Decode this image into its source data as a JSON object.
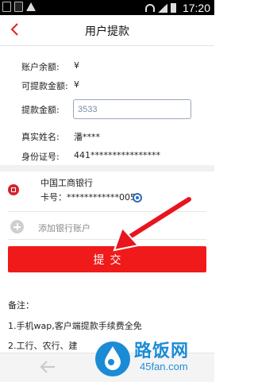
{
  "status_bar": {
    "time": "17:20"
  },
  "header": {
    "title": "用户提款"
  },
  "account": {
    "balance_label": "账户余额:",
    "balance_value": "¥",
    "withdrawable_label": "可提款金额:",
    "withdrawable_value": "¥",
    "amount_label": "提款金额:",
    "amount_value": "3533",
    "real_name_label": "真实姓名:",
    "real_name_value": "潘****",
    "id_label": "身份证号:",
    "id_value": "441****************"
  },
  "bank_card": {
    "bank_name": "中国工商银行",
    "card_label": "卡号：",
    "card_number": "************0052",
    "selected": true
  },
  "add_bank": {
    "label": "添加银行账户"
  },
  "submit": {
    "label": "提交"
  },
  "notes": {
    "title": "备注：",
    "items": [
      "1.手机wap,客户端提款手续费全免",
      "2.工行、农行、建"
    ]
  },
  "watermark": {
    "name": "路饭网",
    "url": "45fan.com"
  },
  "colors": {
    "accent": "#f01a1a",
    "radio": "#2b6db7",
    "watermark": "#1b8bd6"
  }
}
